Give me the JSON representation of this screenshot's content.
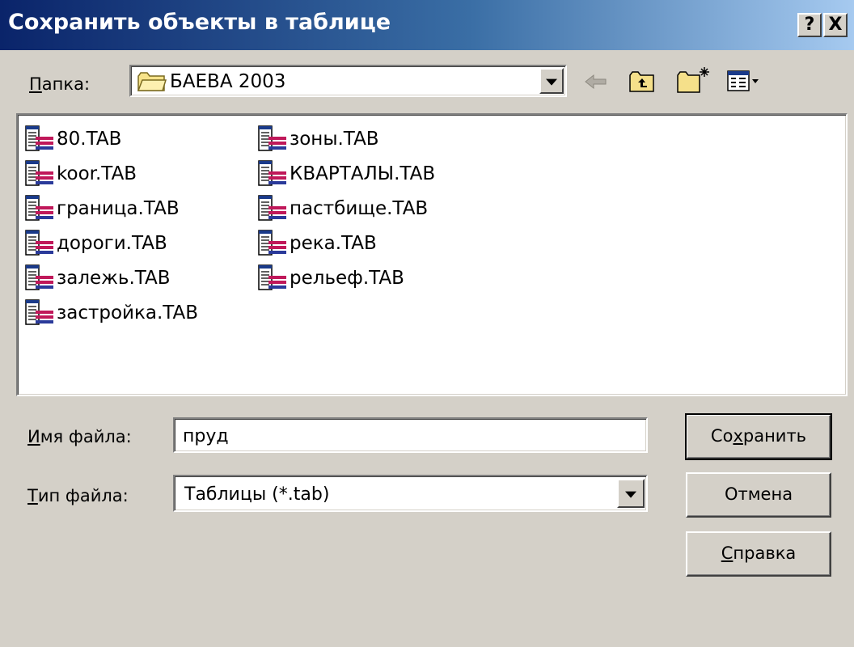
{
  "window": {
    "title": "Сохранить объекты в таблице",
    "help_button": "?",
    "close_button": "X"
  },
  "location": {
    "label_first": "П",
    "label_rest": "апка:",
    "folder": "БАЕВА 2003"
  },
  "files": {
    "column1": [
      "80.TAB",
      "koor.TAB",
      "граница.TAB",
      "дороги.TAB",
      "залежь.TAB",
      "застройка.TAB"
    ],
    "column2": [
      "зоны.TAB",
      "КВАРТАЛЫ.TAB",
      "пастбище.TAB",
      "река.TAB",
      "рельеф.TAB"
    ]
  },
  "filename": {
    "label_first": "И",
    "label_rest": "мя файла:",
    "value": "пруд"
  },
  "filetype": {
    "label_first": "Т",
    "label_rest": "ип файла:",
    "value": "Таблицы (*.tab)"
  },
  "buttons": {
    "save_pre": "Со",
    "save_u": "х",
    "save_post": "ранить",
    "cancel": "Отмена",
    "help_u": "С",
    "help_post": "правка"
  },
  "icons": {
    "back": "back-arrow-icon",
    "up": "up-folder-icon",
    "new_folder": "new-folder-icon",
    "view_menu": "view-menu-icon",
    "file": "table-file-icon",
    "folder": "folder-icon"
  }
}
